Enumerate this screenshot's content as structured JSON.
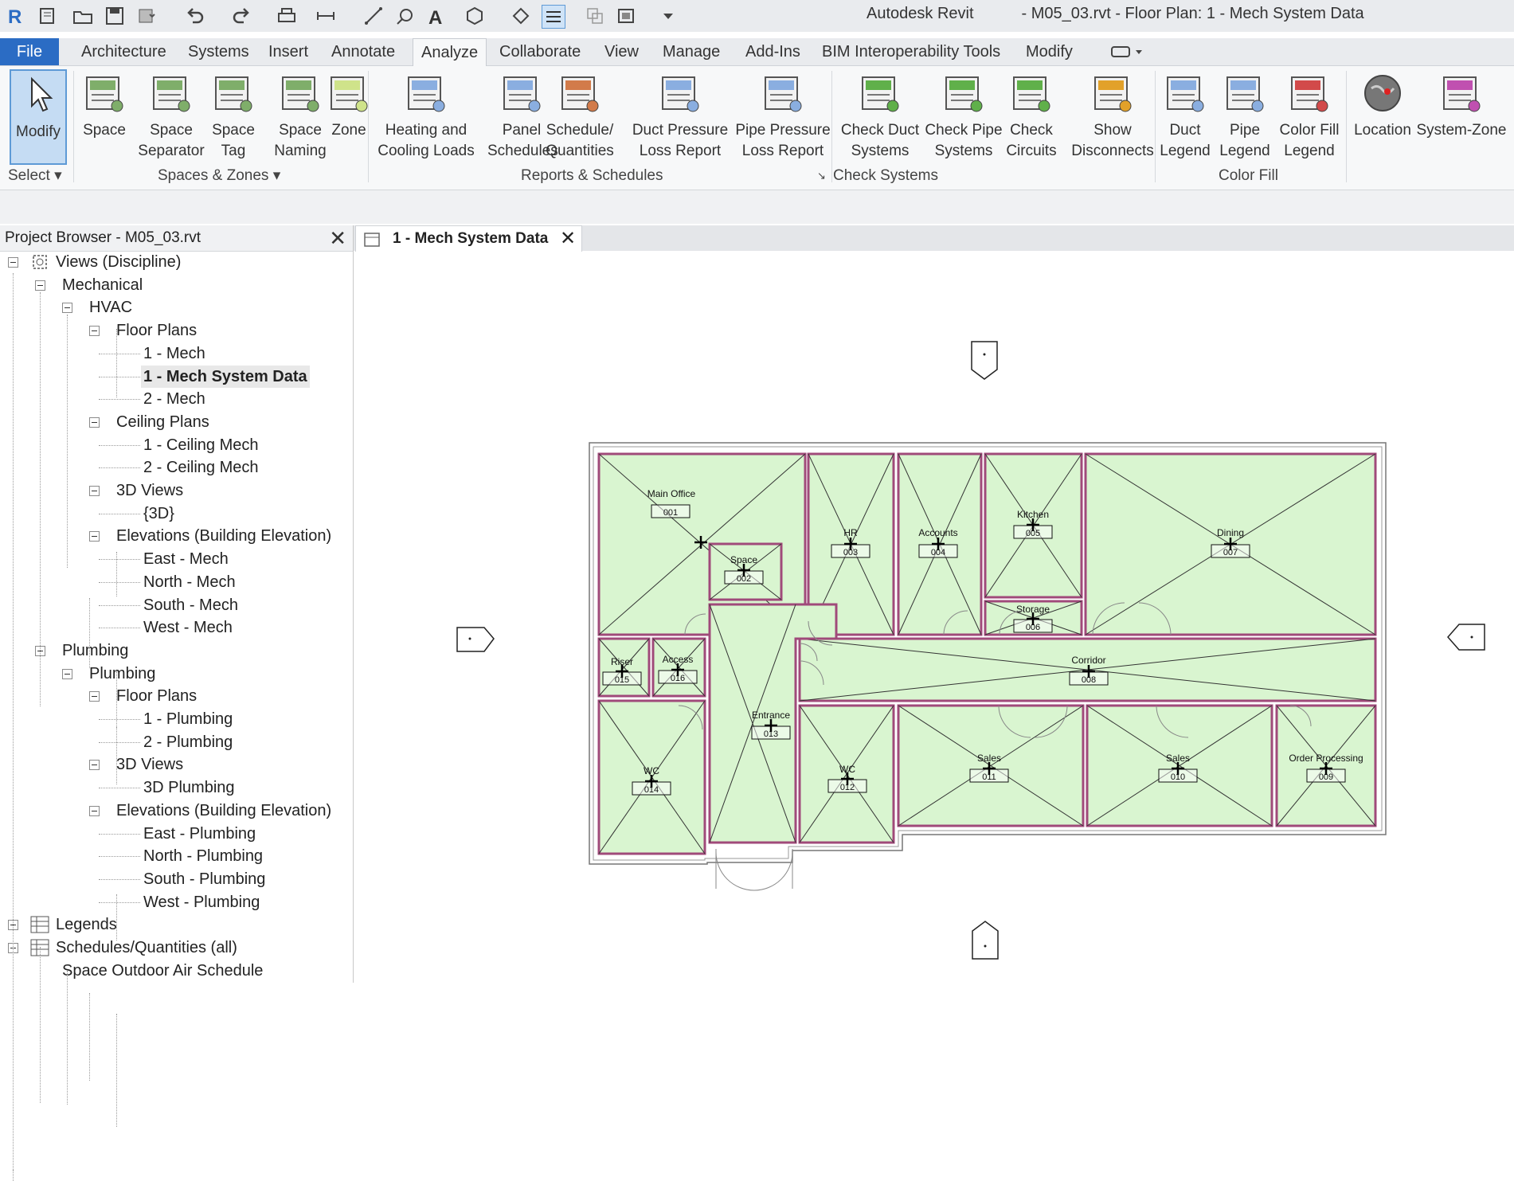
{
  "app": {
    "name": "Autodesk Revit",
    "document_title": "- M05_03.rvt - Floor Plan: 1 - Mech System Data"
  },
  "quick_access": [
    "revit-logo-icon",
    "open-icon",
    "folder-icon",
    "save-icon",
    "sync-icon",
    "undo-icon",
    "redo-icon",
    "print-icon",
    "measure-icon",
    "dimension-icon",
    "tag-icon",
    "text-icon",
    "3d-view-icon",
    "section-icon",
    "thin-lines-icon",
    "close-hidden-icon",
    "switch-windows-icon",
    "customize-icon"
  ],
  "menu": {
    "tabs": [
      "File",
      "Architecture",
      "Systems",
      "Insert",
      "Annotate",
      "Analyze",
      "Collaborate",
      "View",
      "Manage",
      "Add-Ins",
      "BIM Interoperability Tools",
      "Modify"
    ],
    "active": "Analyze"
  },
  "ribbon": {
    "buttons": [
      {
        "id": "modify",
        "l1": "Modify",
        "l2": ""
      },
      {
        "id": "space",
        "l1": "Space",
        "l2": ""
      },
      {
        "id": "space-separator",
        "l1": "Space",
        "l2": "Separator"
      },
      {
        "id": "space-tag",
        "l1": "Space",
        "l2": "Tag"
      },
      {
        "id": "space-naming",
        "l1": "Space",
        "l2": "Naming"
      },
      {
        "id": "zone",
        "l1": "Zone",
        "l2": ""
      },
      {
        "id": "heating-cooling",
        "l1": "Heating and",
        "l2": "Cooling Loads"
      },
      {
        "id": "panel-schedules",
        "l1": "Panel",
        "l2": "Schedules"
      },
      {
        "id": "schedule-quantities",
        "l1": "Schedule/",
        "l2": "Quantities"
      },
      {
        "id": "duct-pressure",
        "l1": "Duct Pressure",
        "l2": "Loss Report"
      },
      {
        "id": "pipe-pressure",
        "l1": "Pipe Pressure",
        "l2": "Loss Report"
      },
      {
        "id": "check-duct",
        "l1": "Check Duct",
        "l2": "Systems"
      },
      {
        "id": "check-pipe",
        "l1": "Check Pipe",
        "l2": "Systems"
      },
      {
        "id": "check-circuits",
        "l1": "Check",
        "l2": "Circuits"
      },
      {
        "id": "show-disconnects",
        "l1": "Show",
        "l2": "Disconnects"
      },
      {
        "id": "duct-legend",
        "l1": "Duct",
        "l2": "Legend"
      },
      {
        "id": "pipe-legend",
        "l1": "Pipe",
        "l2": "Legend"
      },
      {
        "id": "color-fill-legend",
        "l1": "Color Fill",
        "l2": "Legend"
      },
      {
        "id": "location",
        "l1": "Location",
        "l2": ""
      },
      {
        "id": "system-zone",
        "l1": "System-Zone",
        "l2": ""
      }
    ],
    "panels": [
      "Select",
      "Spaces & Zones",
      "Reports & Schedules",
      "Check Systems",
      "Color Fill"
    ]
  },
  "project_browser": {
    "title": "Project Browser - M05_03.rvt",
    "nodes": [
      {
        "t": "Views (Discipline)",
        "lvl": 0,
        "box": true
      },
      {
        "t": "Mechanical",
        "lvl": 1,
        "box": true
      },
      {
        "t": "HVAC",
        "lvl": 2,
        "box": true
      },
      {
        "t": "Floor Plans",
        "lvl": 3,
        "box": true
      },
      {
        "t": "1 - Mech",
        "lvl": 4
      },
      {
        "t": "1 - Mech System Data",
        "lvl": 4,
        "sel": true
      },
      {
        "t": "2 - Mech",
        "lvl": 4
      },
      {
        "t": "Ceiling Plans",
        "lvl": 3,
        "box": true
      },
      {
        "t": "1 - Ceiling Mech",
        "lvl": 4
      },
      {
        "t": "2 - Ceiling Mech",
        "lvl": 4
      },
      {
        "t": "3D Views",
        "lvl": 3,
        "box": true
      },
      {
        "t": "{3D}",
        "lvl": 4
      },
      {
        "t": "Elevations (Building Elevation)",
        "lvl": 3,
        "box": true
      },
      {
        "t": "East - Mech",
        "lvl": 4
      },
      {
        "t": "North - Mech",
        "lvl": 4
      },
      {
        "t": "South - Mech",
        "lvl": 4
      },
      {
        "t": "West - Mech",
        "lvl": 4
      },
      {
        "t": "Plumbing",
        "lvl": 1,
        "box": true
      },
      {
        "t": "Plumbing",
        "lvl": 2,
        "box": true
      },
      {
        "t": "Floor Plans",
        "lvl": 3,
        "box": true
      },
      {
        "t": "1 - Plumbing",
        "lvl": 4
      },
      {
        "t": "2 - Plumbing",
        "lvl": 4
      },
      {
        "t": "3D Views",
        "lvl": 3,
        "box": true
      },
      {
        "t": "3D Plumbing",
        "lvl": 4
      },
      {
        "t": "Elevations (Building Elevation)",
        "lvl": 3,
        "box": true
      },
      {
        "t": "East - Plumbing",
        "lvl": 4
      },
      {
        "t": "North - Plumbing",
        "lvl": 4
      },
      {
        "t": "South - Plumbing",
        "lvl": 4
      },
      {
        "t": "West - Plumbing",
        "lvl": 4
      },
      {
        "t": "Legends",
        "lvl": 0,
        "box": true
      },
      {
        "t": "Schedules/Quantities (all)",
        "lvl": 0,
        "box": true
      },
      {
        "t": "Space Outdoor Air Schedule",
        "lvl": 1
      }
    ]
  },
  "view_tab": {
    "label": "1 - Mech System Data"
  },
  "plan": {
    "rooms": [
      {
        "name": "Main Office",
        "num": "001"
      },
      {
        "name": "Space",
        "num": "002"
      },
      {
        "name": "HR",
        "num": "003"
      },
      {
        "name": "Accounts",
        "num": "004"
      },
      {
        "name": "Kitchen",
        "num": "005"
      },
      {
        "name": "Storage",
        "num": "006"
      },
      {
        "name": "Dining",
        "num": "007"
      },
      {
        "name": "Corridor",
        "num": "008"
      },
      {
        "name": "Order Processing",
        "num": "009"
      },
      {
        "name": "Sales",
        "num": "010"
      },
      {
        "name": "Sales",
        "num": "011"
      },
      {
        "name": "WC",
        "num": "012"
      },
      {
        "name": "Entrance",
        "num": "013"
      },
      {
        "name": "WC",
        "num": "014"
      },
      {
        "name": "Riser",
        "num": "015"
      },
      {
        "name": "Access",
        "num": "016"
      }
    ],
    "fill_color": "#d9f5d0",
    "wall_color": "#a04a7a"
  }
}
